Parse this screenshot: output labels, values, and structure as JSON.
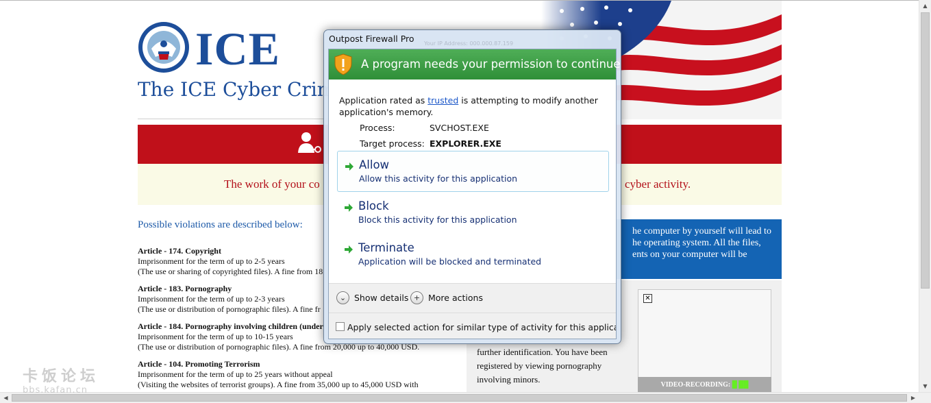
{
  "site": {
    "logo_text": "ICE",
    "title": "The ICE Cyber Crime",
    "notice_left": "The work of your co",
    "notice_right": "cyber activity.",
    "violations_heading": "Possible violations are described below:",
    "articles": [
      {
        "title": "Article - 174. Copyright",
        "line1": "Imprisonment for the term of up to 2-5 years",
        "line2": "(The use or sharing of copyrighted files). A fine from 18"
      },
      {
        "title": "Article - 183. Pornography",
        "line1": "Imprisonment for the term of up to 2-3 years",
        "line2": "(The use or distribution of pornographic files). A fine fr"
      },
      {
        "title": "Article - 184. Pornography involving children (under",
        "line1": "Imprisonment for the term of up to 10-15 years",
        "line2": "(The use or distribution of pornographic files). A fine from 20,000 up to 40,000 USD."
      },
      {
        "title": "Article - 104. Promoting Terrorism",
        "line1": "Imprisonment for the term of up to 25 years without appeal",
        "line2": "(Visiting the websites of terrorist groups). A fine from 35,000 up to 45,000 USD with"
      }
    ],
    "blue_box_lines": [
      "he computer by yourself will lead to",
      "he operating system. All the files,",
      "ents on your computer will be"
    ],
    "grey_box_lines": [
      "further identification. You have been",
      "registered by viewing pornography",
      "involving minors."
    ],
    "video_close_glyph": "✕",
    "video_label": "VIDEO-RECORDING:",
    "video_status": "█ ██"
  },
  "dialog": {
    "window_title": "Outpost Firewall Pro",
    "ghost_text": "Your IP Address: 000.000.87.159",
    "banner": "A program needs your permission to continue",
    "desc_before": "Application rated as ",
    "desc_link": "trusted",
    "desc_after": " is attempting to modify another application's memory.",
    "process_label": "Process:",
    "process_value": "SVCHOST.EXE",
    "target_label": "Target process:",
    "target_value": "EXPLORER.EXE",
    "options": [
      {
        "title": "Allow",
        "subtitle": "Allow this activity for this application"
      },
      {
        "title": "Block",
        "subtitle": "Block this activity for this application"
      },
      {
        "title": "Terminate",
        "subtitle": "Application will be blocked and terminated"
      }
    ],
    "show_details": "Show details",
    "more_actions": "More actions",
    "apply_similar": "Apply selected action for similar type of activity for this application",
    "colors": {
      "banner": "#3a9a42",
      "option_text": "#152f73",
      "link": "#1a56c8"
    }
  },
  "watermark": {
    "chinese": "卡饭论坛",
    "url": "bbs.kafan.cn"
  },
  "scrollbar": {
    "up": "▲",
    "down": "▼",
    "left": "◀",
    "right": "▶"
  }
}
